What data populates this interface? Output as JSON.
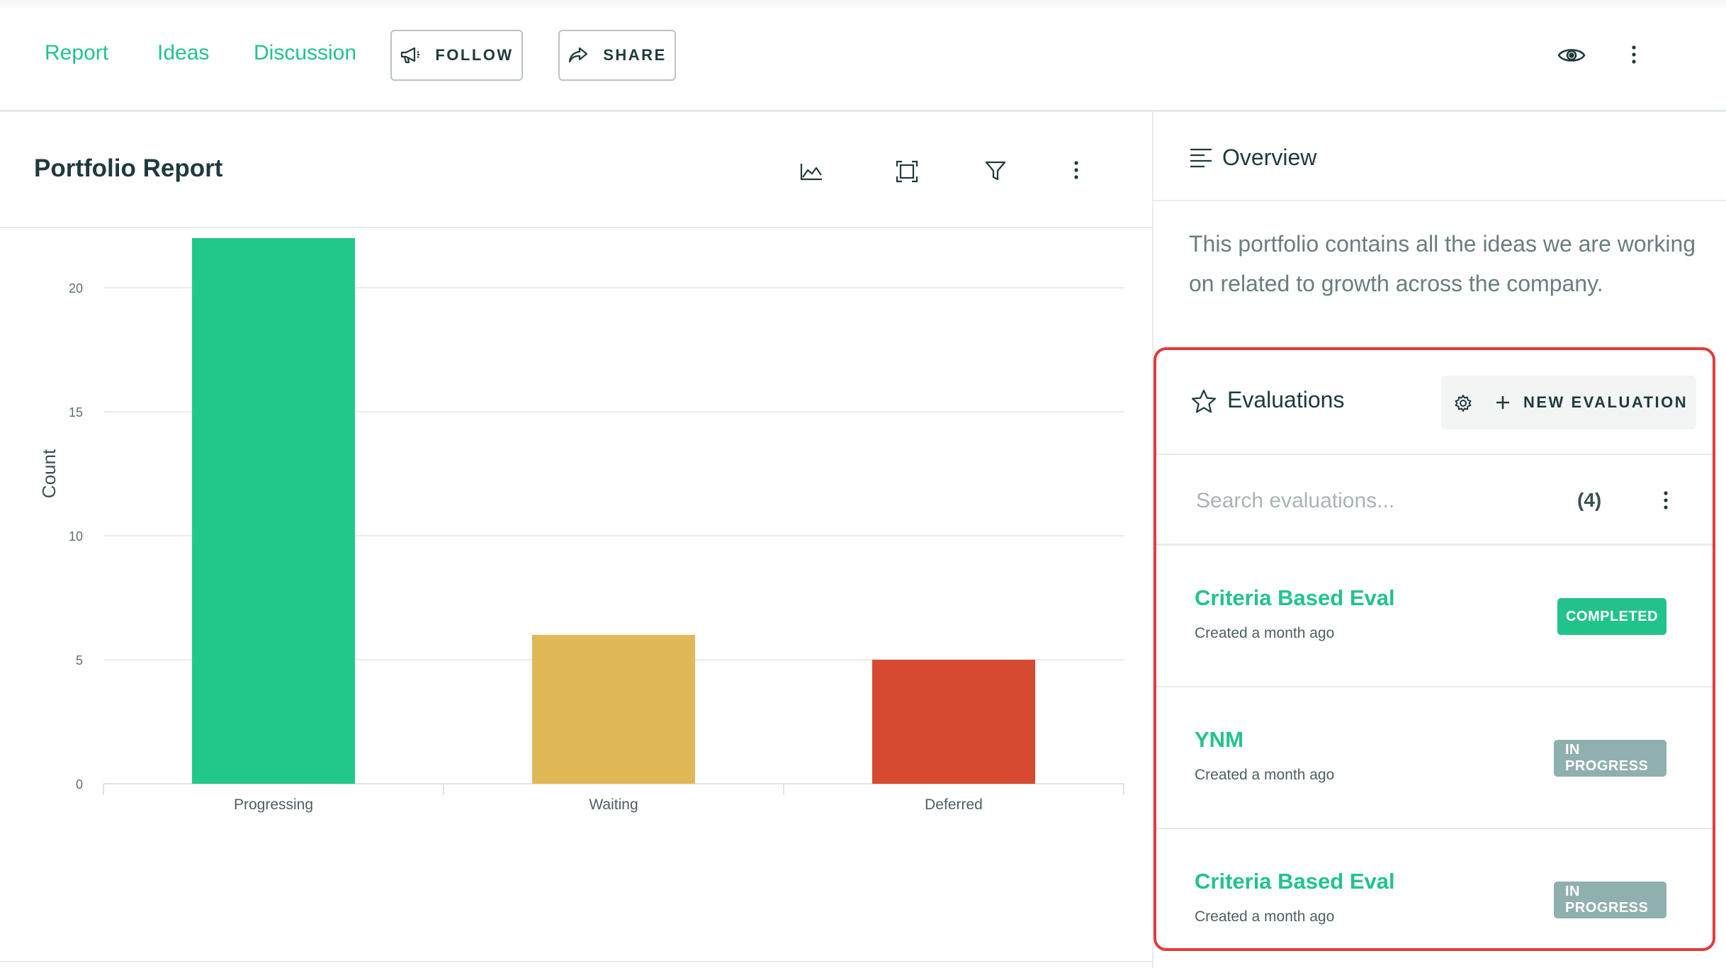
{
  "nav": {
    "links": [
      "Report",
      "Ideas",
      "Discussion"
    ],
    "follow_label": "FOLLOW",
    "share_label": "SHARE"
  },
  "report": {
    "title": "Portfolio Report",
    "toolbar_icons": [
      "chart-icon",
      "fullscreen-icon",
      "filter-icon",
      "more-vertical-icon"
    ]
  },
  "chart_data": {
    "type": "bar",
    "title": "",
    "xlabel": "",
    "ylabel": "Count",
    "ylim": [
      0,
      25
    ],
    "yticks": [
      0,
      5,
      10,
      15,
      20,
      25
    ],
    "categories": [
      "Progressing",
      "Waiting",
      "Deferred"
    ],
    "values": [
      22,
      6,
      5
    ],
    "colors": [
      "#22c88a",
      "#e1b857",
      "#d54a31"
    ],
    "grid": true,
    "legend": "none"
  },
  "overview": {
    "title": "Overview",
    "description": "This portfolio contains all the ideas we are working on related to growth across the company."
  },
  "evaluations": {
    "title": "Evaluations",
    "new_label": "NEW EVALUATION",
    "search_placeholder": "Search evaluations...",
    "count": "(4)",
    "items": [
      {
        "name": "Criteria Based Eval",
        "created": "Created a month ago",
        "status": "COMPLETED",
        "status_color": "#22c38a"
      },
      {
        "name": "YNM",
        "created": "Created a month ago",
        "status": "IN PROGRESS",
        "status_color": "#8fb0ae"
      },
      {
        "name": "Criteria Based Eval",
        "created": "Created a month ago",
        "status": "IN PROGRESS",
        "status_color": "#8fb0ae"
      }
    ]
  }
}
